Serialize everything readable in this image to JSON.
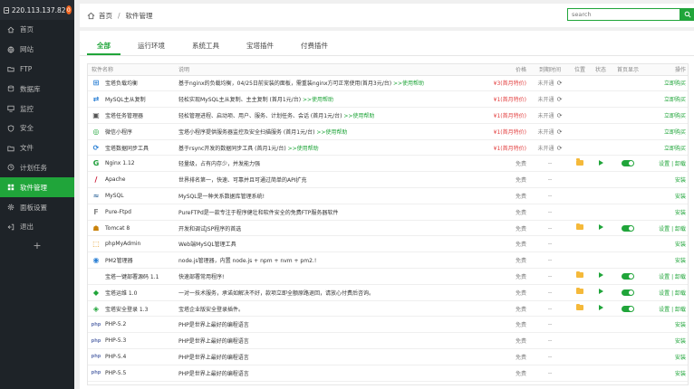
{
  "sidebar": {
    "server_ip": "220.113.137.82",
    "badge": "0",
    "items": [
      {
        "label": "首页",
        "icon": "home-icon"
      },
      {
        "label": "网站",
        "icon": "globe-icon"
      },
      {
        "label": "FTP",
        "icon": "ftp-icon"
      },
      {
        "label": "数据库",
        "icon": "database-icon"
      },
      {
        "label": "监控",
        "icon": "monitor-icon"
      },
      {
        "label": "安全",
        "icon": "shield-icon"
      },
      {
        "label": "文件",
        "icon": "folder-icon"
      },
      {
        "label": "计划任务",
        "icon": "clock-icon"
      },
      {
        "label": "软件管理",
        "icon": "grid-icon"
      },
      {
        "label": "面板设置",
        "icon": "gear-icon"
      },
      {
        "label": "退出",
        "icon": "logout-icon"
      }
    ],
    "active_index": 8,
    "add_label": "+"
  },
  "breadcrumb": {
    "home": "首页",
    "separator": "/",
    "current": "软件管理"
  },
  "search": {
    "placeholder": "search"
  },
  "tabs": [
    {
      "label": "全部"
    },
    {
      "label": "运行环境"
    },
    {
      "label": "系统工具"
    },
    {
      "label": "宝塔插件"
    },
    {
      "label": "付费插件"
    }
  ],
  "table": {
    "headers": {
      "name": "软件名称",
      "desc": "说明",
      "price": "价格",
      "expire": "到期时间",
      "location": "位置",
      "status": "状态",
      "home": "首页显示",
      "action": "操作"
    },
    "rows": [
      {
        "name": "宝塔负载均衡",
        "icon": "load-balance-icon",
        "desc": "基于nginx的负载均衡，04/25日前安装的面板，需重装nginx方可正常使用(首月3元/台)",
        "help": ">>使用帮助",
        "price": "¥3(首月特价)",
        "expire": "未开通",
        "action": "立即购买"
      },
      {
        "name": "MySQL主从复制",
        "icon": "mysql-replication-icon",
        "desc": "轻松实现MySQL主从复制、主主复制 (首月1元/台)",
        "help": ">>使用帮助",
        "price": "¥1(首月特价)",
        "expire": "未开通",
        "action": "立即购买"
      },
      {
        "name": "宝塔任务管理器",
        "icon": "task-manager-icon",
        "desc": "轻松管理进程、启动项、用户、服务、计划任务、会话 (首月1元/台)",
        "help": ">>使用帮助",
        "price": "¥1(首月特价)",
        "expire": "未开通",
        "action": "立即购买"
      },
      {
        "name": "微信小程序",
        "icon": "wechat-icon",
        "desc": "宝塔小程序提供服务器监控及安全扫描服务 (首月1元/台)",
        "help": ">>使用帮助",
        "price": "¥1(首月特价)",
        "expire": "未开通",
        "action": "立即购买"
      },
      {
        "name": "宝塔数据同步工具",
        "icon": "data-sync-icon",
        "desc": "基于rsync开发的数据同步工具 (首月1元/台)",
        "help": ">>使用帮助",
        "price": "¥1(首月特价)",
        "expire": "未开通",
        "action": "立即购买"
      },
      {
        "name": "Nginx 1.12",
        "icon": "nginx-icon",
        "desc": "轻量级，占有内存少，并发能力强",
        "price": "免费",
        "expire": "--",
        "installed": true,
        "action": "设置 | 卸载"
      },
      {
        "name": "Apache",
        "icon": "apache-icon",
        "desc": "世界排名第一，快速、可靠并且可通过简单的API扩充",
        "price": "免费",
        "expire": "--",
        "action": "安装"
      },
      {
        "name": "MySQL",
        "icon": "mysql-icon",
        "desc": "MySQL是一种关系数据库管理系统!",
        "price": "免费",
        "expire": "--",
        "action": "安装"
      },
      {
        "name": "Pure-Ftpd",
        "icon": "ftp-server-icon",
        "desc": "PureFTPd是一款专注于程序健壮和软件安全的免费FTP服务器软件",
        "price": "免费",
        "expire": "--",
        "action": "安装"
      },
      {
        "name": "Tomcat 8",
        "icon": "tomcat-icon",
        "desc": "开发和调试JSP程序的首选",
        "price": "免费",
        "expire": "--",
        "installed": true,
        "action": "设置 | 卸载"
      },
      {
        "name": "phpMyAdmin",
        "icon": "phpmyadmin-icon",
        "desc": "Web端MySQL管理工具",
        "price": "免费",
        "expire": "--",
        "action": "安装"
      },
      {
        "name": "PM2管理器",
        "icon": "pm2-icon",
        "desc": "node.js管理器，内置 node.js + npm + nvm + pm2.!",
        "price": "免费",
        "expire": "--",
        "action": "安装"
      },
      {
        "name": "宝塔一键部署源码 1.1",
        "icon": "code-icon",
        "desc": "快速部署常用程序!",
        "price": "免费",
        "expire": "--",
        "installed": true,
        "action": "设置 | 卸载"
      },
      {
        "name": "宝塔运维 1.0",
        "icon": "ops-icon",
        "desc": "一对一技术服务，承诺如解决不好，款项立即全额原路退回，请放心付费后咨询。",
        "price": "免费",
        "expire": "--",
        "installed": true,
        "action": "设置 | 卸载"
      },
      {
        "name": "宝塔安全登录 1.3",
        "icon": "secure-login-icon",
        "desc": "宝塔企业版安全登录插件。",
        "price": "免费",
        "expire": "--",
        "installed": true,
        "action": "设置 | 卸载"
      },
      {
        "name": "PHP-5.2",
        "icon": "php-icon",
        "desc": "PHP是世界上最好的编程语言",
        "price": "免费",
        "expire": "--",
        "action": "安装"
      },
      {
        "name": "PHP-5.3",
        "icon": "php-icon",
        "desc": "PHP是世界上最好的编程语言",
        "price": "免费",
        "expire": "--",
        "action": "安装"
      },
      {
        "name": "PHP-5.4",
        "icon": "php-icon",
        "desc": "PHP是世界上最好的编程语言",
        "price": "免费",
        "expire": "--",
        "action": "安装"
      },
      {
        "name": "PHP-5.5",
        "icon": "php-icon",
        "desc": "PHP是世界上最好的编程语言",
        "price": "免费",
        "expire": "--",
        "action": "安装"
      }
    ]
  },
  "colors": {
    "accent": "#20a53a",
    "price": "#e23d3d",
    "sidebar": "#1e2328",
    "badge": "#f0641e"
  }
}
